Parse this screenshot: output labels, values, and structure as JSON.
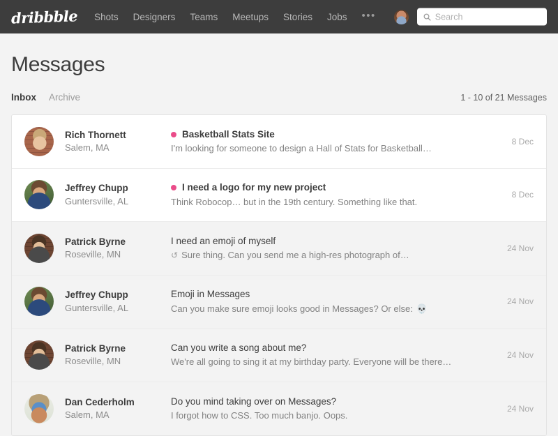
{
  "nav": {
    "logo": "dribbble",
    "links": [
      {
        "label": "Shots"
      },
      {
        "label": "Designers"
      },
      {
        "label": "Teams"
      },
      {
        "label": "Meetups"
      },
      {
        "label": "Stories"
      },
      {
        "label": "Jobs"
      }
    ],
    "more_label": "•••",
    "icons": [
      {
        "name": "user-avatar",
        "label": ""
      },
      {
        "name": "messages-envelope-icon",
        "label": ""
      },
      {
        "name": "activity-pulse-icon",
        "label": ""
      },
      {
        "name": "buckets-flame-icon",
        "label": ""
      }
    ],
    "has_message_notification": true
  },
  "search": {
    "placeholder": "Search",
    "value": ""
  },
  "page": {
    "title": "Messages",
    "tabs": [
      {
        "label": "Inbox",
        "active": true
      },
      {
        "label": "Archive",
        "active": false
      }
    ],
    "count_text": "1 - 10 of 21 Messages"
  },
  "colors": {
    "nav_background": "#3d3d3d",
    "page_background": "#f3f3f3",
    "accent_pink": "#ea4c89",
    "row_unread_background": "#ffffff",
    "text_primary": "#3d3d3d",
    "text_muted": "#8b8b8b"
  },
  "messages": [
    {
      "sender": "Rich Thornett",
      "location": "Salem, MA",
      "subject": "Basketball Stats Site",
      "preview": "I'm looking for someone to design a Hall of Stats for Basketball…",
      "date": "8 Dec",
      "unread": true,
      "replied": false,
      "emoji": "",
      "avatar_class": "av-rich"
    },
    {
      "sender": "Jeffrey Chupp",
      "location": "Guntersville, AL",
      "subject": "I need a logo for my new project",
      "preview": "Think Robocop… but in the 19th century. Something like that.",
      "date": "8 Dec",
      "unread": true,
      "replied": false,
      "emoji": "",
      "avatar_class": "av-jeffrey"
    },
    {
      "sender": "Patrick Byrne",
      "location": "Roseville, MN",
      "subject": "I need an emoji of myself",
      "preview": "Sure thing. Can you send me a high-res photograph of…",
      "date": "24 Nov",
      "unread": false,
      "replied": true,
      "emoji": "",
      "avatar_class": "av-patrick"
    },
    {
      "sender": "Jeffrey Chupp",
      "location": "Guntersville, AL",
      "subject": "Emoji in Messages",
      "preview": "Can you make sure emoji looks good in Messages? Or else:",
      "date": "24 Nov",
      "unread": false,
      "replied": false,
      "emoji": "💀",
      "avatar_class": "av-jeffrey"
    },
    {
      "sender": "Patrick Byrne",
      "location": "Roseville, MN",
      "subject": "Can you write a song about me?",
      "preview": "We're all going to sing it at my birthday party. Everyone will be there…",
      "date": "24 Nov",
      "unread": false,
      "replied": false,
      "emoji": "",
      "avatar_class": "av-patrick"
    },
    {
      "sender": "Dan Cederholm",
      "location": "Salem, MA",
      "subject": "Do you mind taking over on Messages?",
      "preview": "I forgot how to CSS. Too much banjo. Oops.",
      "date": "24 Nov",
      "unread": false,
      "replied": false,
      "emoji": "",
      "avatar_class": "av-dan"
    }
  ]
}
